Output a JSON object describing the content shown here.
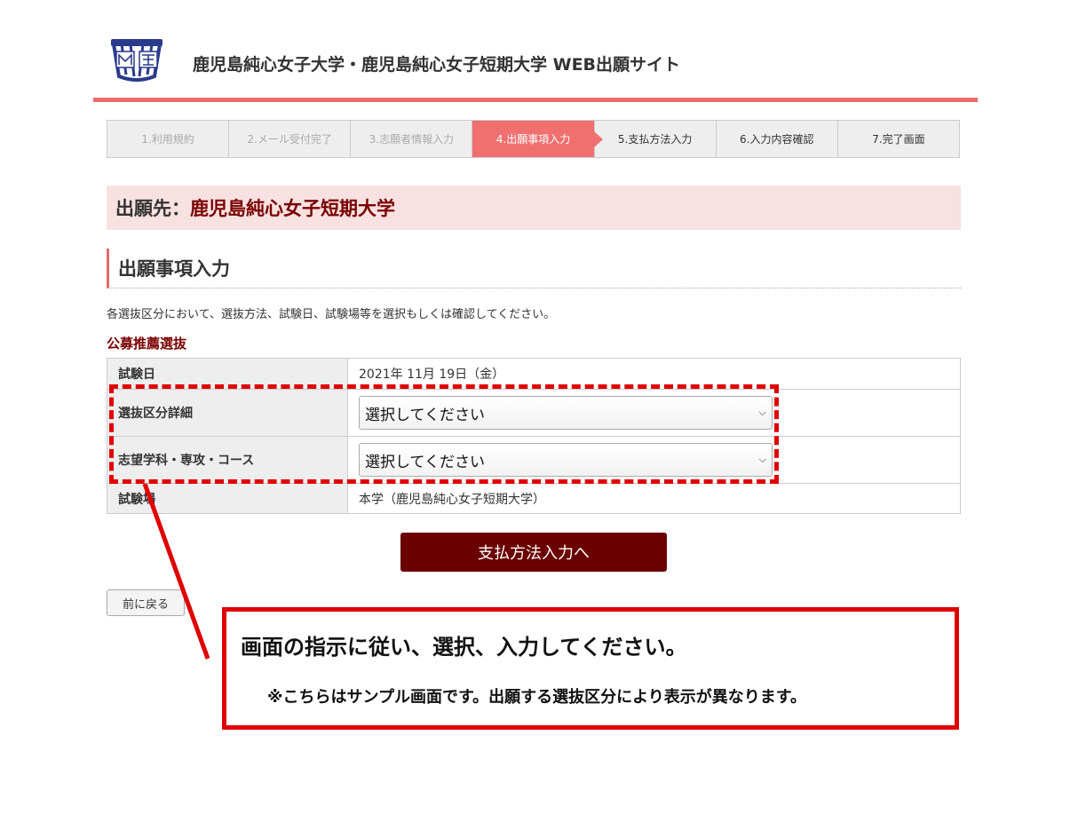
{
  "header": {
    "title": "鹿児島純心女子大学・鹿児島純心女子短期大学 WEB出願サイト",
    "logo_icon": "university-crest-icon"
  },
  "steps": [
    {
      "label": "1.利用規約",
      "state": "done"
    },
    {
      "label": "2.メール受付完了",
      "state": "done"
    },
    {
      "label": "3.志願者情報入力",
      "state": "done"
    },
    {
      "label": "4.出願事項入力",
      "state": "active"
    },
    {
      "label": "5.支払方法入力",
      "state": "future"
    },
    {
      "label": "6.入力内容確認",
      "state": "future"
    },
    {
      "label": "7.完了画面",
      "state": "future"
    }
  ],
  "destination": {
    "prefix": "出願先：",
    "name": "鹿児島純心女子短期大学"
  },
  "section": {
    "title": "出願事項入力",
    "instruction": "各選抜区分において、選抜方法、試験日、試験場等を選択もしくは確認してください。",
    "category": "公募推薦選抜"
  },
  "form": {
    "exam_date": {
      "label": "試験日",
      "value": "2021年 11月 19日（金）"
    },
    "selection_detail": {
      "label": "選抜区分詳細",
      "value": "選択してください"
    },
    "department": {
      "label": "志望学科・専攻・コース",
      "value": "選択してください"
    },
    "venue": {
      "label": "試験場",
      "value": "本学（鹿児島純心女子短期大学）"
    }
  },
  "buttons": {
    "submit": "支払方法入力へ",
    "back": "前に戻る"
  },
  "callout": {
    "main": "画面の指示に従い、選択、入力してください。",
    "note": "※こちらはサンプル画面です。出願する選抜区分により表示が異なります。"
  },
  "colors": {
    "accent": "#ee6b6b",
    "brand_dark": "#6b0000",
    "annotation_red": "#e00000",
    "destination_bg": "#f8e1e1"
  }
}
